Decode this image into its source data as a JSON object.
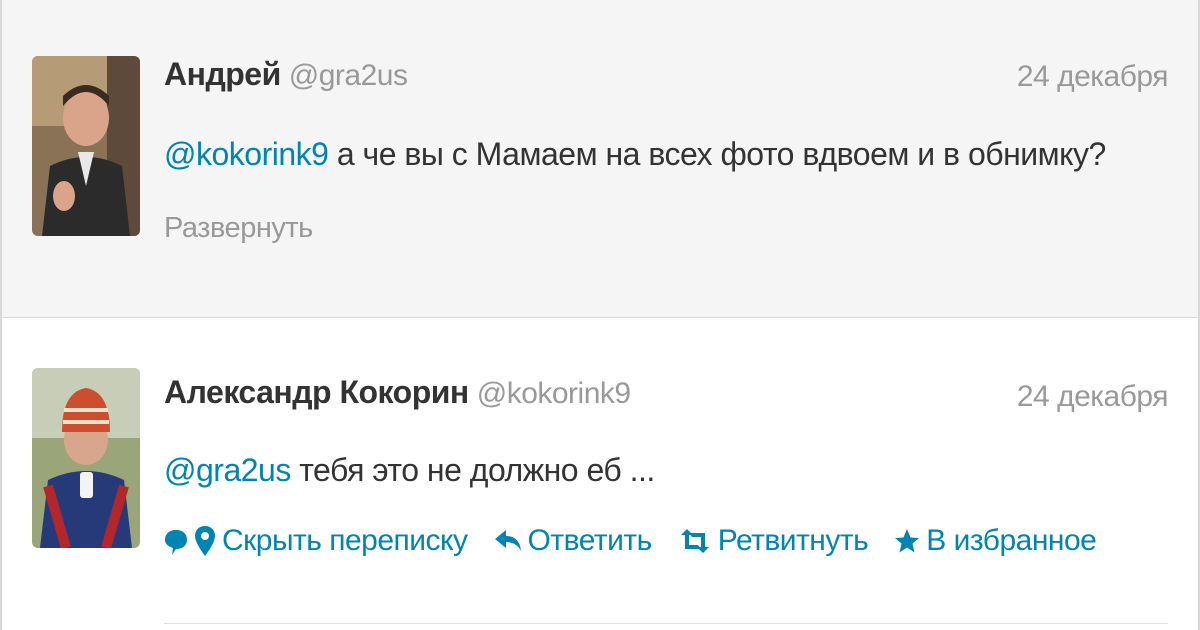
{
  "tweets": [
    {
      "name": "Андрей",
      "handle": "@gra2us",
      "date": "24 декабря",
      "mention": "@kokorink9",
      "text": " а че вы с Мамаем на всех фото вдвоем и в обнимку?",
      "expand": "Развернуть"
    },
    {
      "name": "Александр Кокорин",
      "handle": "@kokorink9",
      "date": "24 декабря",
      "mention": "@gra2us",
      "text": " тебя это не должно еб ...",
      "actions": {
        "hide": "Скрыть переписку",
        "reply": "Ответить",
        "retweet": "Ретвитнуть",
        "favorite": "В избранное"
      }
    }
  ],
  "colors": {
    "link": "#0084b4",
    "name": "#333333",
    "meta": "#999999",
    "highlight_bg": "#f5f5f5"
  },
  "icons": [
    "conversation-icon",
    "location-pin-icon",
    "reply-icon",
    "retweet-icon",
    "star-icon"
  ]
}
